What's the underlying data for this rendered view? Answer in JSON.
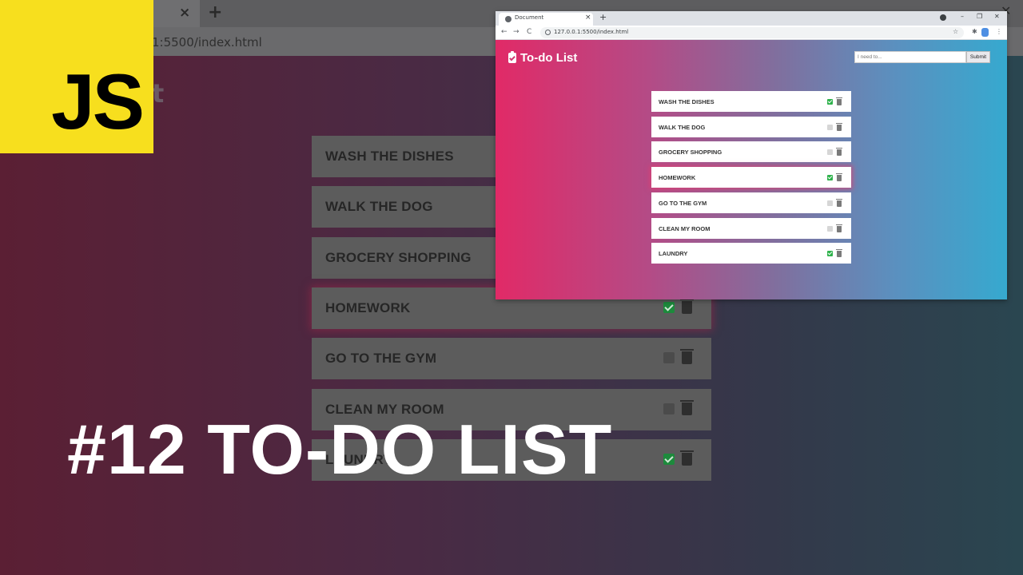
{
  "background": {
    "tab_close": "×",
    "new_tab": "+",
    "url_fragment": "1:5500/index.html",
    "title_fragment": "st",
    "window_close": "✕"
  },
  "logo": {
    "text": "JS",
    "color": "#f7df1e"
  },
  "headline": "#12 TO-DO LIST",
  "browser": {
    "tab_title": "Document",
    "tab_close": "×",
    "new_tab": "+",
    "controls": {
      "minimize": "–",
      "maximize": "❐",
      "close": "✕"
    },
    "nav": {
      "back": "←",
      "forward": "→",
      "reload": "C"
    },
    "url": "127.0.0.1:5500/index.html",
    "toolbar_icons": {
      "star": "☆",
      "extensions": "✱",
      "menu": "⋮"
    }
  },
  "app": {
    "title": "To-do List",
    "input_placeholder": "I need to...",
    "submit_label": "Submit",
    "gradient": {
      "left": "#e12a67",
      "right": "#36a9cf"
    },
    "items": [
      {
        "label": "WASH THE DISHES",
        "checked": true,
        "highlighted": false
      },
      {
        "label": "WALK THE DOG",
        "checked": false,
        "highlighted": false
      },
      {
        "label": "GROCERY SHOPPING",
        "checked": false,
        "highlighted": false
      },
      {
        "label": "HOMEWORK",
        "checked": true,
        "highlighted": true
      },
      {
        "label": "GO TO THE GYM",
        "checked": false,
        "highlighted": false
      },
      {
        "label": "CLEAN MY ROOM",
        "checked": false,
        "highlighted": false
      },
      {
        "label": "LAUNDRY",
        "checked": true,
        "highlighted": false
      }
    ]
  }
}
